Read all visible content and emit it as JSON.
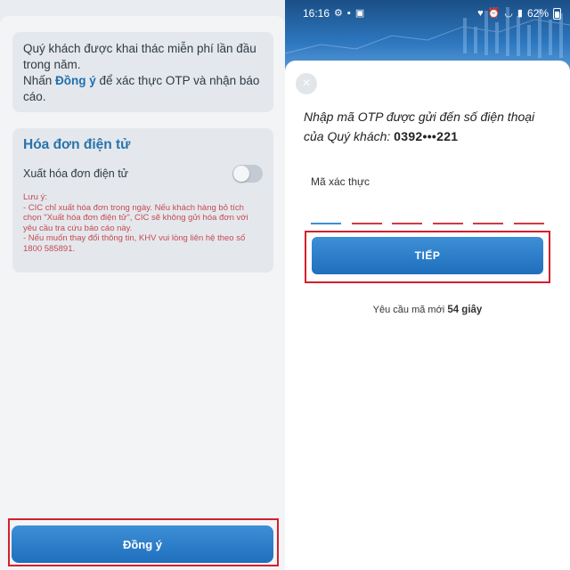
{
  "left": {
    "info": {
      "line1": "Quý khách được khai thác miễn phí lần đầu trong năm.",
      "line2_pre": "Nhấn ",
      "line2_link": "Đồng ý",
      "line2_post": " để xác thực OTP và nhận báo cáo."
    },
    "invoice": {
      "title": "Hóa đơn điện tử",
      "toggle_label": "Xuất hóa đơn điện tử",
      "toggle_on": false,
      "notes": [
        "Lưu ý:",
        "- CIC chỉ xuất hóa đơn trong ngày. Nếu khách hàng bỏ tích chọn \"Xuất hóa đơn điện tử\", CIC sẽ không gửi hóa đơn với yêu cầu tra cứu báo cáo này.",
        "- Nếu muốn thay đổi thông tin, KHV vui lòng liên hệ theo số 1800 585891."
      ]
    },
    "agree_button": "Đồng ý"
  },
  "right": {
    "status_bar": {
      "time": "16:16",
      "battery": "62%",
      "left_icons": [
        "settings-icon",
        "chat-icon",
        "image-icon"
      ],
      "right_icons": [
        "heart-icon",
        "alarm-icon",
        "wifi-icon",
        "signal-icon",
        "battery-icon"
      ]
    },
    "otp": {
      "prompt": "Nhập mã OTP được gửi đến số điện thoại của Quý khách: ",
      "phone": "0392•••221",
      "code_label": "Mã xác thực",
      "slots": 6,
      "next_button": "TIẾP",
      "resend_pre": "Yêu cầu mã mới ",
      "resend_count": "54 giây"
    }
  },
  "colors": {
    "accent": "#2a73ad",
    "button": "#1f6fbd",
    "highlight": "#d4202b",
    "note": "#c64a52"
  }
}
